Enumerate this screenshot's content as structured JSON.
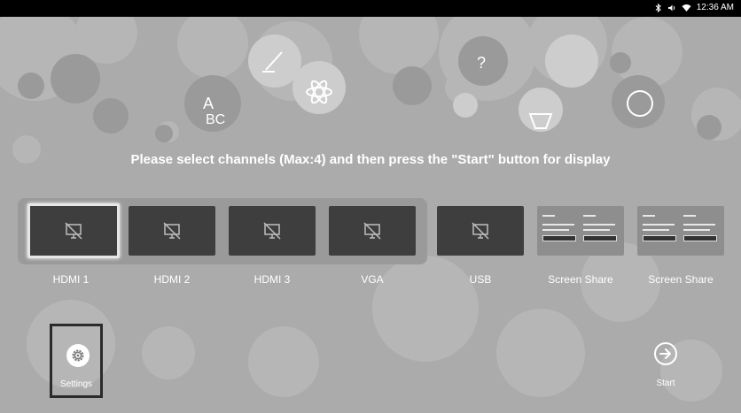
{
  "status_bar": {
    "icons": [
      "bluetooth-icon",
      "volume-icon",
      "wifi-icon"
    ],
    "time": "12:36 AM"
  },
  "headline": "Please select channels (Max:4) and then press the \"Start\" button for display",
  "channels": [
    {
      "label": "HDMI 1",
      "selected": true
    },
    {
      "label": "HDMI 2",
      "selected": false
    },
    {
      "label": "HDMI 3",
      "selected": false
    },
    {
      "label": "VGA",
      "selected": false
    },
    {
      "label": "USB",
      "selected": false
    },
    {
      "label": "Screen Share",
      "selected": false
    },
    {
      "label": "Screen Share",
      "selected": false
    }
  ],
  "settings": {
    "label": "Settings",
    "icon": "gear-icon"
  },
  "start": {
    "label": "Start",
    "icon": "arrow-right-circle-icon"
  },
  "colors": {
    "background": "#ababab",
    "tile": "#3e3e3e",
    "status_bar": "#000000"
  }
}
